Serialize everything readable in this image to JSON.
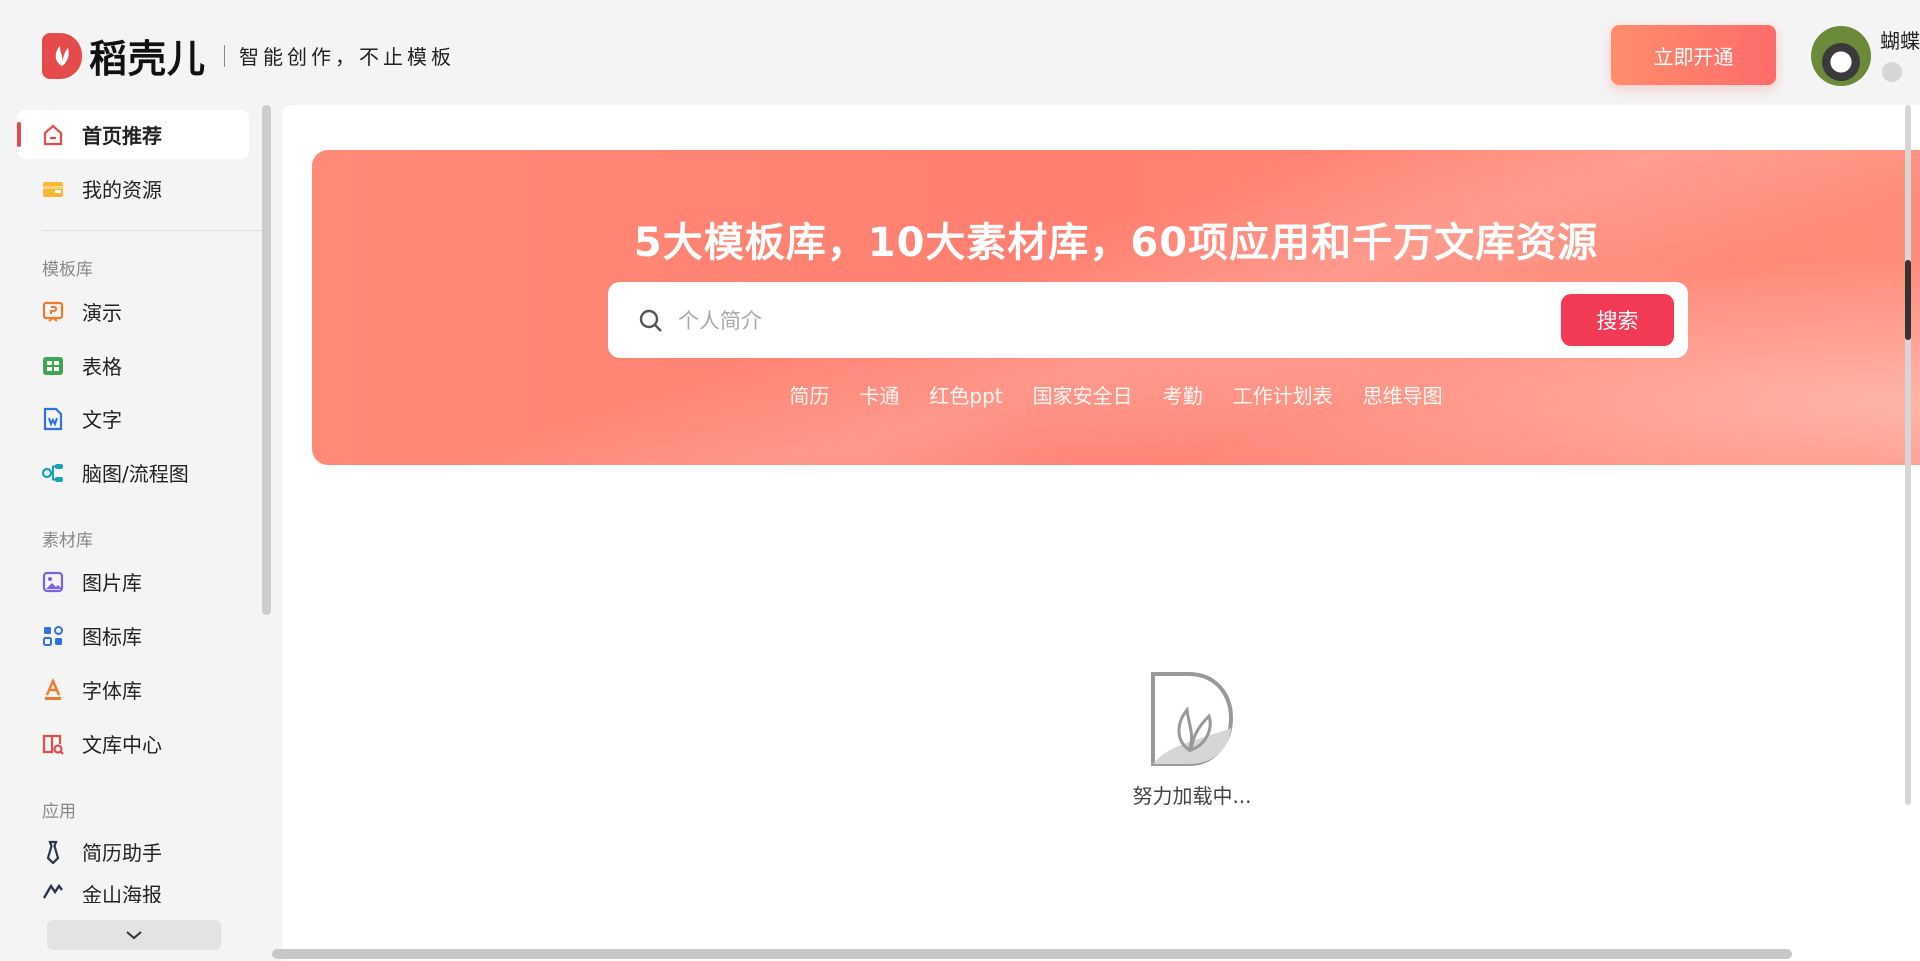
{
  "header": {
    "brand_name": "稻壳儿",
    "slogan": "智能创作，不止模板",
    "open_button": "立即开通",
    "user_name": "蝴蝶"
  },
  "sidebar": {
    "top_items": [
      {
        "label": "首页推荐",
        "icon": "home-icon",
        "active": true
      },
      {
        "label": "我的资源",
        "icon": "wallet-icon",
        "active": false
      }
    ],
    "sections": [
      {
        "title": "模板库",
        "items": [
          {
            "label": "演示",
            "icon": "presentation-icon"
          },
          {
            "label": "表格",
            "icon": "spreadsheet-icon"
          },
          {
            "label": "文字",
            "icon": "document-icon"
          },
          {
            "label": "脑图/流程图",
            "icon": "mindmap-icon"
          }
        ]
      },
      {
        "title": "素材库",
        "items": [
          {
            "label": "图片库",
            "icon": "image-icon"
          },
          {
            "label": "图标库",
            "icon": "icons-grid-icon"
          },
          {
            "label": "字体库",
            "icon": "font-icon"
          },
          {
            "label": "文库中心",
            "icon": "library-icon"
          }
        ]
      },
      {
        "title": "应用",
        "items": [
          {
            "label": "简历助手",
            "icon": "tie-icon"
          },
          {
            "label": "金山海报",
            "icon": "poster-icon"
          }
        ]
      }
    ]
  },
  "hero": {
    "title": "5大模板库，10大素材库，60项应用和千万文库资源",
    "search_placeholder": "个人简介",
    "search_button": "搜索",
    "hot_tags": [
      "简历",
      "卡通",
      "红色ppt",
      "国家安全日",
      "考勤",
      "工作计划表",
      "思维导图"
    ]
  },
  "loading": {
    "text": "努力加载中..."
  },
  "colors": {
    "brand": "#e64b4b",
    "hero_bg": "#ff8476",
    "search_button": "#f23a55",
    "open_button": "#ff7d6b"
  }
}
